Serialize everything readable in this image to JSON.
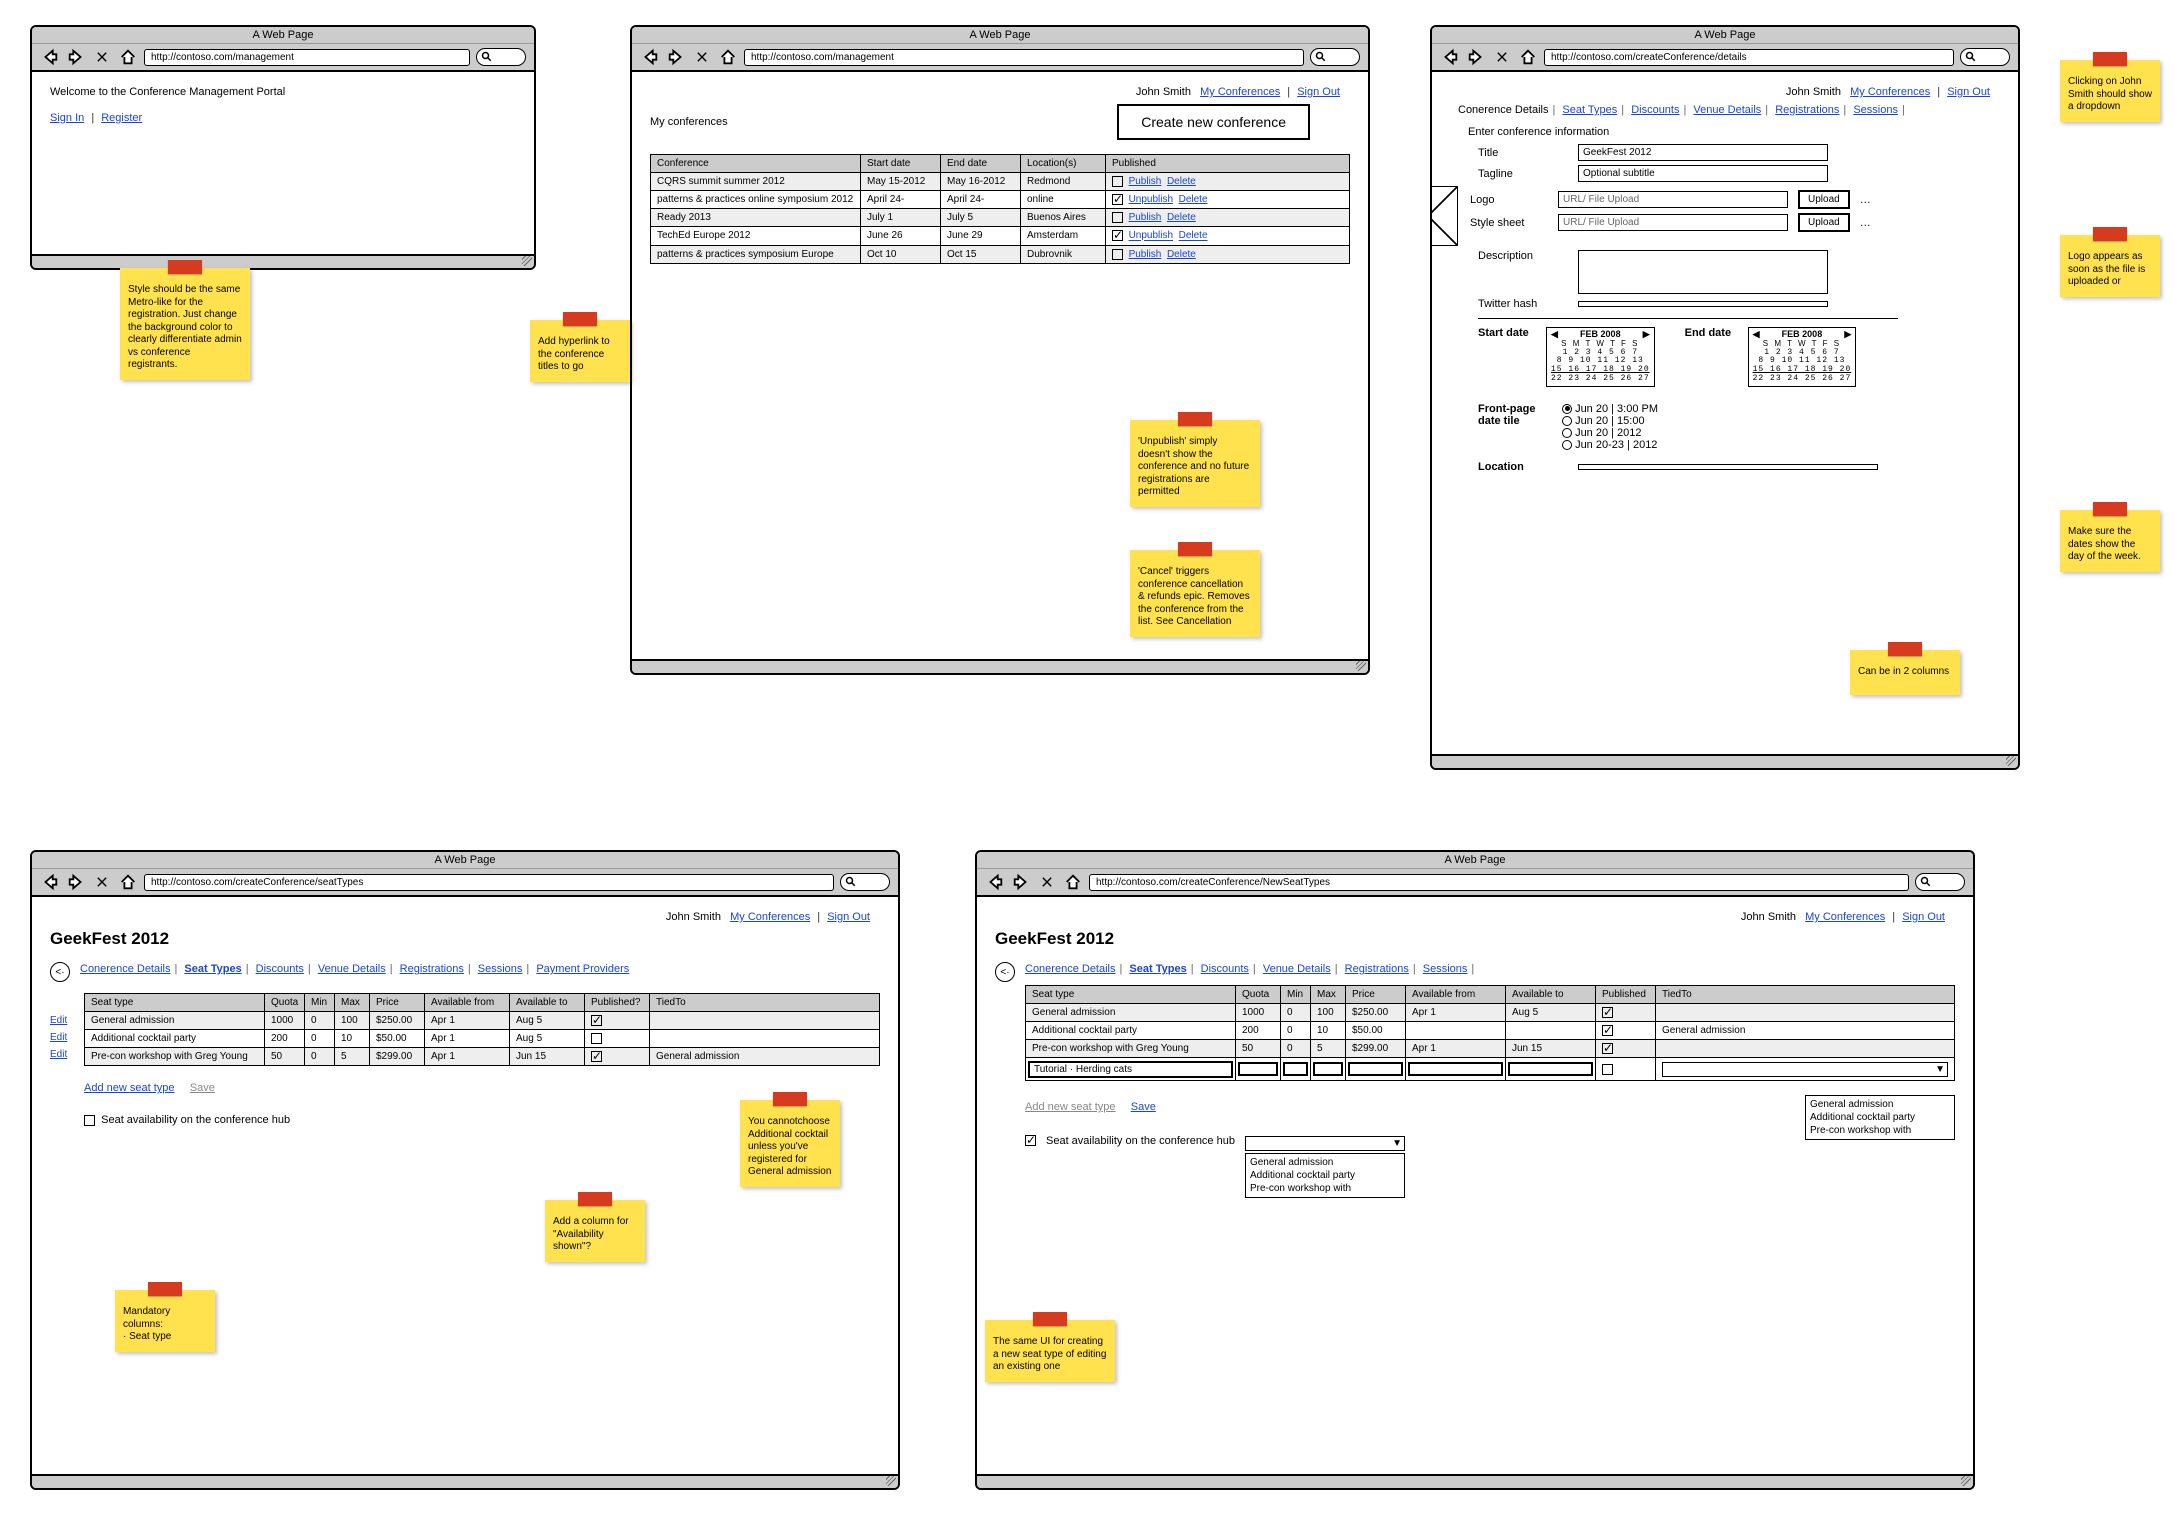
{
  "common": {
    "window_title": "A Web Page",
    "user": "John Smith",
    "nav_my_conferences": "My Conferences",
    "nav_sign_out": "Sign Out"
  },
  "w1": {
    "url": "http://contoso.com/management",
    "welcome": "Welcome to the Conference Management Portal",
    "sign_in": "Sign In",
    "register": "Register",
    "note": "Style should be the same Metro-like for the registration. Just change the background color to clearly differentiate admin vs conference registrants."
  },
  "w2": {
    "url": "http://contoso.com/management",
    "heading": "My conferences",
    "create_btn": "Create new conference",
    "cols": {
      "c0": "Conference",
      "c1": "Start date",
      "c2": "End date",
      "c3": "Location(s)",
      "c4": "Published"
    },
    "rows": [
      {
        "name": "CQRS summit summer 2012",
        "start": "May 15-2012",
        "end": "May 16-2012",
        "loc": "Redmond",
        "pub": false,
        "act1": "Publish",
        "act2": "Delete"
      },
      {
        "name": "patterns & practices online symposium 2012",
        "start": "April 24-",
        "end": "April 24-",
        "loc": "online",
        "pub": true,
        "act1": "Unpublish",
        "act2": "Delete"
      },
      {
        "name": "Ready 2013",
        "start": "July 1",
        "end": "July 5",
        "loc": "Buenos Aires",
        "pub": false,
        "act1": "Publish",
        "act2": "Delete"
      },
      {
        "name": "TechEd Europe 2012",
        "start": "June 26",
        "end": "June 29",
        "loc": "Amsterdam",
        "pub": true,
        "act1": "Unpublish",
        "act2": "Delete"
      },
      {
        "name": "patterns & practices symposium Europe",
        "start": "Oct 10",
        "end": "Oct 15",
        "loc": "Dubrovnik",
        "pub": false,
        "act1": "Publish",
        "act2": "Delete"
      }
    ],
    "note_left": "Add hyperlink to the conference titles to go",
    "note_unpublish": "'Unpublish' simply doesn't show the conference and no future registrations are permitted",
    "note_cancel": "'Cancel' triggers conference cancellation & refunds epic. Removes the conference from the list. See Cancellation"
  },
  "w3": {
    "url": "http://contoso.com/createConference/details",
    "tabs": {
      "t0": "Conerence Details",
      "t1": "Seat Types",
      "t2": "Discounts",
      "t3": "Venue Details",
      "t4": "Registrations",
      "t5": "Sessions"
    },
    "subhead": "Enter conference information",
    "labels": {
      "title": "Title",
      "tagline": "Tagline",
      "logo": "Logo",
      "style": "Style sheet",
      "desc": "Description",
      "twitter": "Twitter hash",
      "start": "Start date",
      "end": "End date",
      "front": "Front-page date tile",
      "location": "Location"
    },
    "values": {
      "title": "GeekFest 2012",
      "tagline_ph": "Optional subtitle",
      "upload_ph": "URL/ File Upload",
      "upload_btn": "Upload",
      "ellipsis": "…"
    },
    "cal": {
      "title": "FEB 2008",
      "dow": "S M T W T F S"
    },
    "radios": {
      "r0": "Jun 20 | 3:00 PM",
      "r1": "Jun 20 | 15:00",
      "r2": "Jun 20 | 2012",
      "r3": "Jun 20-23 | 2012"
    },
    "note_dropdown": "Clicking on John Smith should show a dropdown",
    "note_logo": "Logo appears as soon as the file is uploaded or",
    "note_dates": "Make sure the dates show the day of the week.",
    "note_2col": "Can be in 2 columns"
  },
  "w4": {
    "url": "http://contoso.com/createConference/seatTypes",
    "page_title": "GeekFest 2012",
    "tabs": {
      "t0": "Conerence Details",
      "t1": "Seat Types",
      "t2": "Discounts",
      "t3": "Venue Details",
      "t4": "Registrations",
      "t5": "Sessions",
      "t6": "Payment Providers"
    },
    "cols": {
      "c0": "Seat type",
      "c1": "Quota",
      "c2": "Min",
      "c3": "Max",
      "c4": "Price",
      "c5": "Available from",
      "c6": "Available to",
      "c7": "Published?",
      "c8": "TiedTo"
    },
    "edit": "Edit",
    "rows": [
      {
        "name": "General admission",
        "quota": "1000",
        "min": "0",
        "max": "100",
        "price": "$250.00",
        "from": "Apr 1",
        "to": "Aug 5",
        "pub": true,
        "tied": ""
      },
      {
        "name": "Additional cocktail party",
        "quota": "200",
        "min": "0",
        "max": "10",
        "price": "$50.00",
        "from": "Apr 1",
        "to": "Aug 5",
        "pub": false,
        "tied": ""
      },
      {
        "name": "Pre-con workshop with Greg Young",
        "quota": "50",
        "min": "0",
        "max": "5",
        "price": "$299.00",
        "from": "Apr 1",
        "to": "Jun 15",
        "pub": true,
        "tied": "General admission"
      }
    ],
    "add_link": "Add new seat type",
    "save_link": "Save",
    "avail_label": "Seat availability on the conference hub",
    "note_mandatory": "Mandatory columns:\n  ·  Seat type",
    "note_column": "Add a column for \"Availability shown\"?",
    "note_tied": "You cannotchoose Additional cocktail unless you've registered for General admission"
  },
  "w5": {
    "url": "http://contoso.com/createConference/NewSeatTypes",
    "page_title": "GeekFest 2012",
    "tabs": {
      "t0": "Conerence Details",
      "t1": "Seat Types",
      "t2": "Discounts",
      "t3": "Venue Details",
      "t4": "Registrations",
      "t5": "Sessions"
    },
    "cols": {
      "c0": "Seat type",
      "c1": "Quota",
      "c2": "Min",
      "c3": "Max",
      "c4": "Price",
      "c5": "Available from",
      "c6": "Available to",
      "c7": "Published",
      "c8": "TiedTo"
    },
    "rows": [
      {
        "name": "General admission",
        "quota": "1000",
        "min": "0",
        "max": "100",
        "price": "$250.00",
        "from": "Apr 1",
        "to": "Aug 5",
        "pub": true,
        "tied": ""
      },
      {
        "name": "Additional cocktail party",
        "quota": "200",
        "min": "0",
        "max": "10",
        "price": "$50.00",
        "from": "",
        "to": "",
        "pub": true,
        "tied": "General admission"
      },
      {
        "name": "Pre-con workshop with Greg Young",
        "quota": "50",
        "min": "0",
        "max": "5",
        "price": "$299.00",
        "from": "Apr 1",
        "to": "Jun 15",
        "pub": true,
        "tied": ""
      }
    ],
    "new_row_name": "Tutorial · Herding cats",
    "add_link": "Add new seat type",
    "save_link": "Save",
    "avail_label": "Seat availability on the conference hub",
    "combo_value": "",
    "combo_options": {
      "o0": "General admission",
      "o1": "Additional cocktail party",
      "o2": "Pre-con workshop with"
    },
    "tied_dd": {
      "o0": "General admission",
      "o1": "Additional cocktail party",
      "o2": "Pre-con workshop with"
    },
    "note_same_ui": "The same UI for creating a new seat type of editing an existing one"
  }
}
